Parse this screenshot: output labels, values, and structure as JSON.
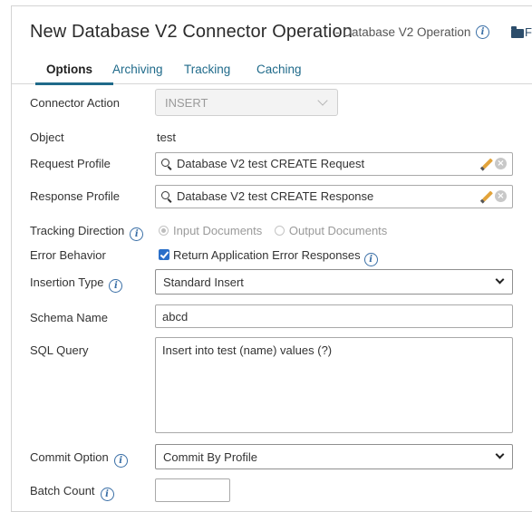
{
  "header": {
    "title": "New Database V2 Connector Operation",
    "subtitle": "- Database V2 Operation",
    "folder_text": "F"
  },
  "tabs": [
    {
      "label": "Options",
      "active": true
    },
    {
      "label": "Archiving",
      "active": false
    },
    {
      "label": "Tracking",
      "active": false
    },
    {
      "label": "Caching",
      "active": false
    }
  ],
  "form": {
    "connector_action": {
      "label": "Connector Action",
      "value": "INSERT",
      "disabled": true
    },
    "object": {
      "label": "Object",
      "value": "test"
    },
    "request_profile": {
      "label": "Request Profile",
      "value": "Database V2 test CREATE Request"
    },
    "response_profile": {
      "label": "Response Profile",
      "value": "Database V2 test CREATE Response"
    },
    "tracking_direction": {
      "label": "Tracking Direction",
      "options": [
        "Input Documents",
        "Output Documents"
      ],
      "selected": "Input Documents",
      "disabled": true
    },
    "error_behavior": {
      "label": "Error Behavior",
      "checkbox_label": "Return Application Error Responses",
      "checked": true
    },
    "insertion_type": {
      "label": "Insertion Type",
      "value": "Standard Insert"
    },
    "schema_name": {
      "label": "Schema Name",
      "value": "abcd"
    },
    "sql_query": {
      "label": "SQL Query",
      "value": "Insert into test (name) values (?)"
    },
    "commit_option": {
      "label": "Commit Option",
      "value": "Commit By Profile"
    },
    "batch_count": {
      "label": "Batch Count",
      "value": ""
    }
  },
  "icons": {
    "info": "info-icon",
    "search": "search-icon",
    "edit": "pencil-icon",
    "clear": "clear-icon",
    "folder": "folder-icon"
  },
  "colors": {
    "tab_accent": "#1f6a8a",
    "info_icon": "#3a6fa6",
    "checkbox": "#2a6fc9",
    "pencil": "#e2a33a"
  }
}
